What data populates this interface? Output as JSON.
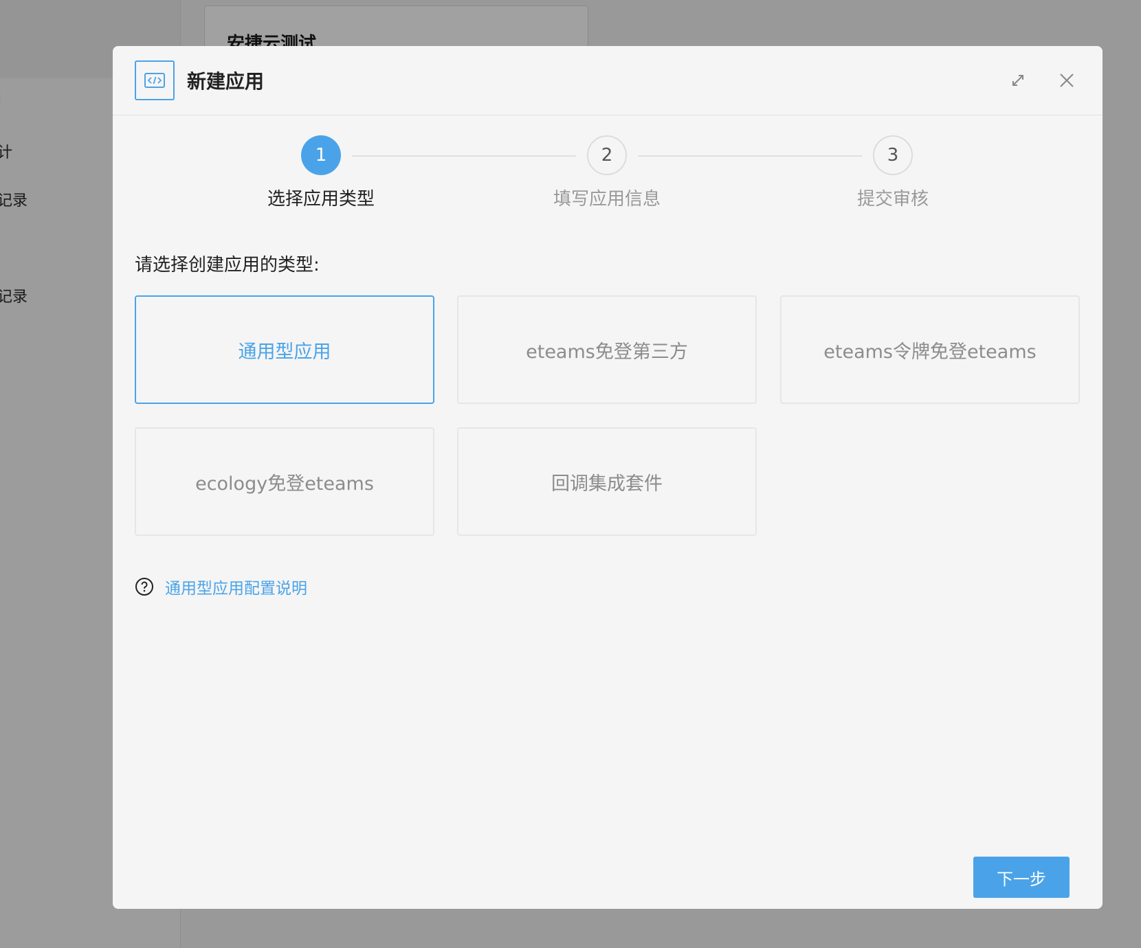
{
  "background": {
    "menu_items": [
      "i",
      "计",
      "记录",
      "记录"
    ],
    "card_title": "安捷云测试"
  },
  "modal": {
    "title": "新建应用",
    "icon": "code-icon",
    "steps": [
      {
        "number": "1",
        "label": "选择应用类型",
        "active": true
      },
      {
        "number": "2",
        "label": "填写应用信息",
        "active": false
      },
      {
        "number": "3",
        "label": "提交审核",
        "active": false
      }
    ],
    "prompt": "请选择创建应用的类型:",
    "types": [
      {
        "label": "通用型应用",
        "selected": true
      },
      {
        "label": "eteams免登第三方",
        "selected": false
      },
      {
        "label": "eteams令牌免登eteams",
        "selected": false
      },
      {
        "label": "ecology免登eteams",
        "selected": false
      },
      {
        "label": "回调集成套件",
        "selected": false
      }
    ],
    "help_link": "通用型应用配置说明",
    "next_button": "下一步"
  },
  "colors": {
    "accent": "#4aa3e8",
    "overlay": "#999999",
    "modal_bg": "#f5f5f5"
  }
}
